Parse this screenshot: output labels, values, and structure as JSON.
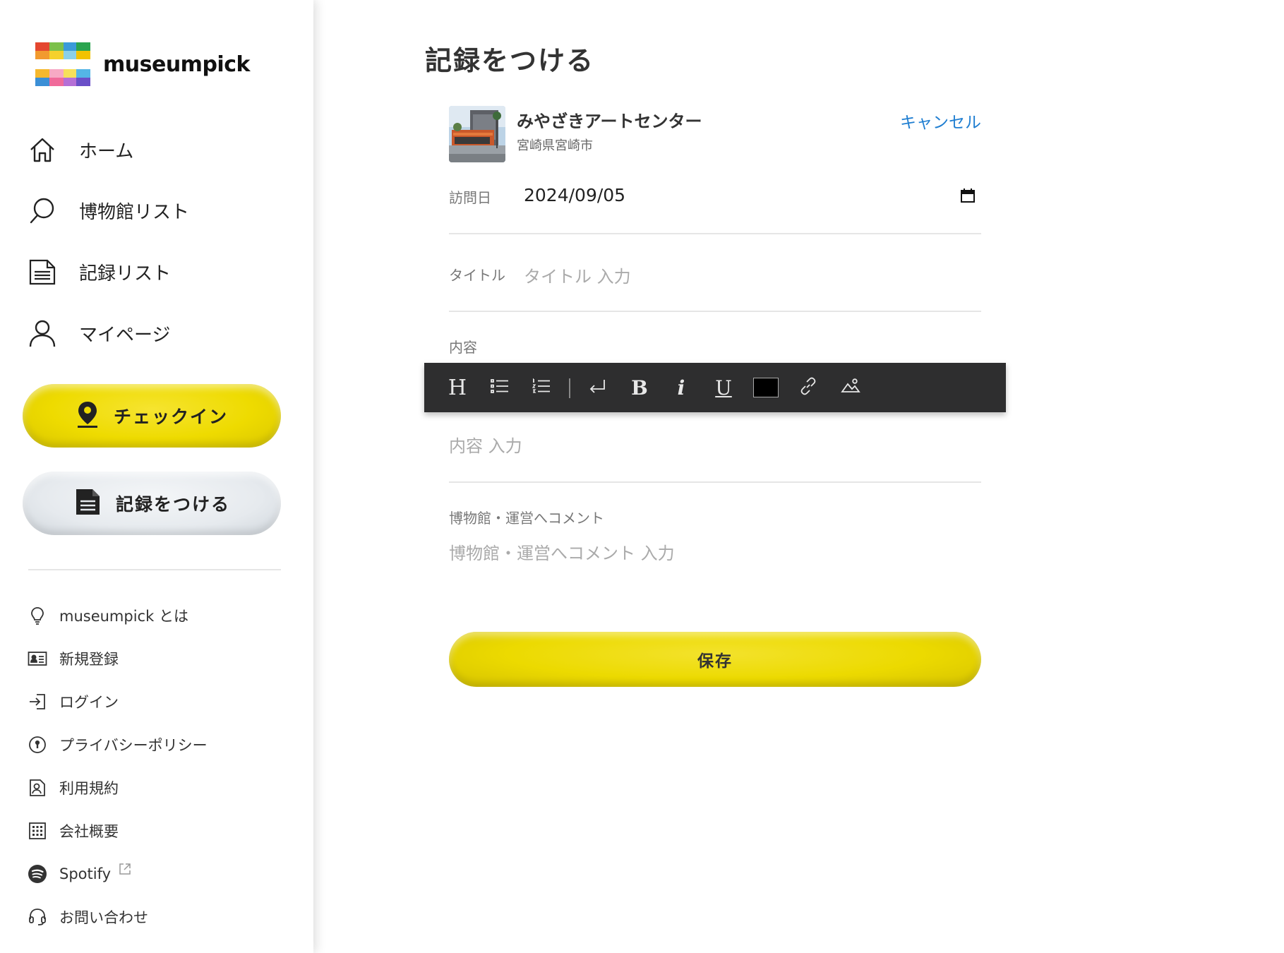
{
  "app": {
    "name": "museumpick"
  },
  "nav": [
    {
      "label": "ホーム",
      "icon": "home-icon"
    },
    {
      "label": "博物館リスト",
      "icon": "search-icon"
    },
    {
      "label": "記録リスト",
      "icon": "document-icon"
    },
    {
      "label": "マイページ",
      "icon": "user-icon"
    }
  ],
  "actions": {
    "checkin_label": "チェックイン",
    "record_label": "記録をつける"
  },
  "sub_nav": [
    {
      "label": "museumpick とは",
      "icon": "lightbulb-icon"
    },
    {
      "label": "新規登録",
      "icon": "id-card-icon"
    },
    {
      "label": "ログイン",
      "icon": "login-icon"
    },
    {
      "label": "プライバシーポリシー",
      "icon": "privacy-icon"
    },
    {
      "label": "利用規約",
      "icon": "terms-icon"
    },
    {
      "label": "会社概要",
      "icon": "building-icon"
    },
    {
      "label": "Spotify",
      "icon": "spotify-icon"
    },
    {
      "label": "お問い合わせ",
      "icon": "headset-icon"
    }
  ],
  "page": {
    "title": "記録をつける",
    "museum": {
      "name": "みやざきアートセンター",
      "location": "宮崎県宮崎市"
    },
    "cancel_label": "キャンセル",
    "visit_date_label": "訪問日",
    "visit_date_value": "2024/09/05",
    "title_label": "タイトル",
    "title_placeholder": "タイトル 入力",
    "content_label": "内容",
    "content_placeholder": "内容 入力",
    "comment_label": "博物館・運営へコメント",
    "comment_placeholder": "博物館・運営へコメント 入力",
    "save_label": "保存"
  },
  "toolbar": {
    "buttons": [
      "heading",
      "bullet-list",
      "numbered-list",
      "line-break",
      "bold",
      "italic",
      "underline",
      "text-color",
      "link",
      "image"
    ],
    "heading_glyph": "H",
    "bold_glyph": "B",
    "italic_glyph": "i",
    "underline_glyph": "U",
    "text_color": "#000000"
  },
  "colors": {
    "accent_yellow": "#eedb00",
    "link_blue": "#1f7ed1",
    "toolbar_bg": "#2e2e2f"
  }
}
